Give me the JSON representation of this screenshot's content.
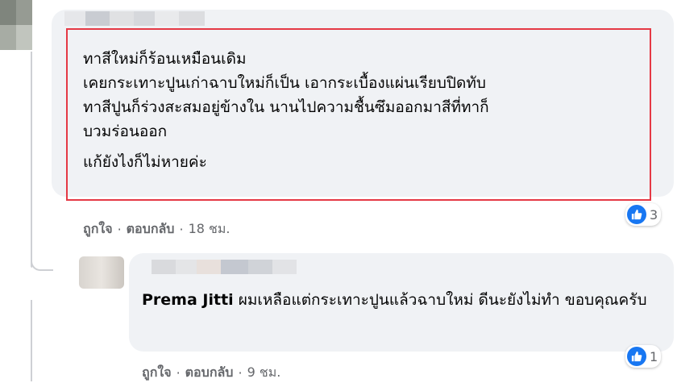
{
  "comment": {
    "text_lines": [
      "ทาสีใหม่ก็ร้อนเหมือนเดิม",
      "เคยกระเทาะปูนเก่าฉาบใหม่ก็เป็น เอากระเบื้องแผ่นเรียบปิดทับ",
      "ทาสีปูนก็ร่วงสะสมอยู่ข้างใน นานไปความชื้นซึมออกมาสีที่ทาก็",
      "บวมร่อนออก"
    ],
    "last_line": "แก้ยังไงก็ไม่หายค่ะ",
    "like_label": "ถูกใจ",
    "reply_label": "ตอบกลับ",
    "time": "18 ชม.",
    "reaction_count": "3",
    "colors": {
      "highlight": "#e53945",
      "like": "#1877f2"
    }
  },
  "reply": {
    "author": "Prema Jitti",
    "text": "ผมเหลือแต่กระเทาะปูนแล้วฉาบใหม่ ดีนะยังไม่ทำ ขอบคุณครับ",
    "like_label": "ถูกใจ",
    "reply_label": "ตอบกลับ",
    "time": "9 ชม.",
    "reaction_count": "1"
  },
  "separator": "·"
}
